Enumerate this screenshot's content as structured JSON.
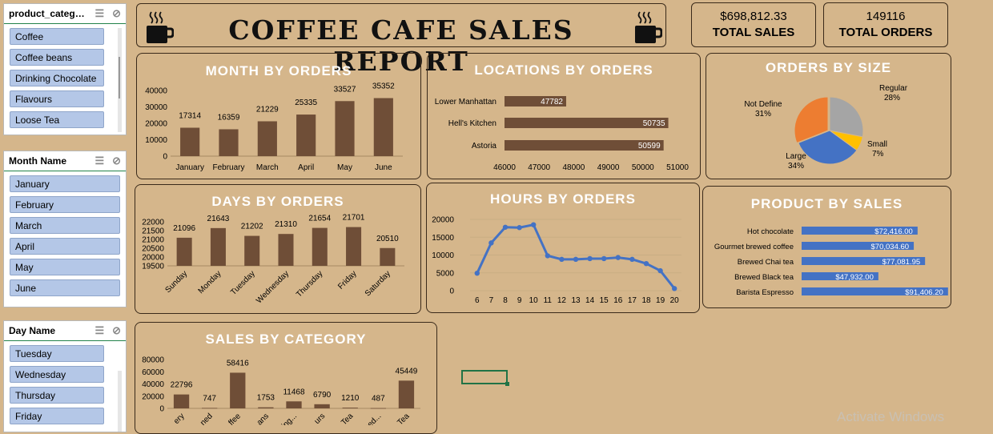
{
  "report_title": "COFFEE CAFE SALES REPORT",
  "kpis": {
    "total_sales_value": "$698,812.33",
    "total_sales_label": "TOTAL SALES",
    "total_orders_value": "149116",
    "total_orders_label": "TOTAL ORDERS"
  },
  "slicers": {
    "category": {
      "title": "product_category",
      "items": [
        "Coffee",
        "Coffee beans",
        "Drinking Chocolate",
        "Flavours",
        "Loose Tea"
      ]
    },
    "month": {
      "title": "Month Name",
      "items": [
        "January",
        "February",
        "March",
        "April",
        "May",
        "June"
      ]
    },
    "day": {
      "title": "Day Name",
      "items": [
        "Tuesday",
        "Wednesday",
        "Thursday",
        "Friday"
      ]
    }
  },
  "watermark": "Activate Windows",
  "chart_data": [
    {
      "id": "month",
      "type": "bar",
      "title": "MONTH BY ORDERS",
      "categories": [
        "January",
        "February",
        "March",
        "April",
        "May",
        "June"
      ],
      "values": [
        17314,
        16359,
        21229,
        25335,
        33527,
        35352
      ],
      "ylim": [
        0,
        40000
      ],
      "yticks": [
        0,
        10000,
        20000,
        30000,
        40000
      ],
      "data_labels": true,
      "color": "#6f4e37"
    },
    {
      "id": "locations",
      "type": "bar",
      "orientation": "horizontal",
      "title": "LOCATIONS BY ORDERS",
      "categories": [
        "Lower Manhattan",
        "Hell's Kitchen",
        "Astoria"
      ],
      "values": [
        47782,
        50735,
        50599
      ],
      "xlim": [
        46000,
        51000
      ],
      "xticks": [
        46000,
        47000,
        48000,
        49000,
        50000,
        51000
      ],
      "data_labels": true,
      "color": "#6f4e37"
    },
    {
      "id": "size",
      "type": "pie",
      "title": "ORDERS BY SIZE",
      "slices": [
        {
          "label": "Regular",
          "value": 28,
          "display": "28%",
          "color": "#a5a5a5"
        },
        {
          "label": "Small",
          "value": 7,
          "display": "7%",
          "color": "#ffc000"
        },
        {
          "label": "Large",
          "value": 34,
          "display": "34%",
          "color": "#4472c4"
        },
        {
          "label": "Not Define",
          "value": 31,
          "display": "31%",
          "color": "#ed7d31"
        }
      ]
    },
    {
      "id": "days",
      "type": "bar",
      "title": "DAYS BY ORDERS",
      "categories": [
        "Sunday",
        "Monday",
        "Tuesday",
        "Wednesday",
        "Thursday",
        "Friday",
        "Saturday"
      ],
      "values": [
        21096,
        21643,
        21202,
        21310,
        21654,
        21701,
        20510
      ],
      "ylim": [
        19500,
        22000
      ],
      "yticks": [
        19500,
        20000,
        20500,
        21000,
        21500,
        22000
      ],
      "data_labels": true,
      "color": "#6f4e37"
    },
    {
      "id": "hours",
      "type": "line",
      "title": "HOURS BY ORDERS",
      "x": [
        6,
        7,
        8,
        9,
        10,
        11,
        12,
        13,
        14,
        15,
        16,
        17,
        18,
        19,
        20
      ],
      "values": [
        4900,
        13400,
        17800,
        17700,
        18500,
        9800,
        8800,
        8800,
        9000,
        9000,
        9300,
        8800,
        7600,
        5600,
        600
      ],
      "ylim": [
        0,
        20000
      ],
      "yticks": [
        0,
        5000,
        10000,
        15000,
        20000
      ],
      "color": "#4472c4"
    },
    {
      "id": "products",
      "type": "bar",
      "orientation": "horizontal",
      "title": "PRODUCT BY SALES",
      "categories": [
        "Hot chocolate",
        "Gourmet brewed coffee",
        "Brewed Chai tea",
        "Brewed Black tea",
        "Barista Espresso"
      ],
      "values": [
        72416.0,
        70034.6,
        77081.95,
        47932.0,
        91406.2
      ],
      "value_labels": [
        "$72,416.00",
        "$70,034.60",
        "$77,081.95",
        "$47,932.00",
        "$91,406.20"
      ],
      "xlim": [
        0,
        100000
      ],
      "color": "#4472c4"
    },
    {
      "id": "category",
      "type": "bar",
      "title": "SALES BY CATEGORY",
      "category_labels": [
        "ery",
        "ned",
        "ffee",
        "ans",
        "ing...",
        "urs",
        "Tea",
        "sed...",
        "Tea"
      ],
      "values": [
        22796,
        747,
        58416,
        1753,
        11468,
        6790,
        1210,
        487,
        45449
      ],
      "ylim": [
        0,
        80000
      ],
      "yticks": [
        0,
        20000,
        40000,
        60000,
        80000
      ],
      "data_labels": true,
      "color": "#6f4e37"
    }
  ]
}
